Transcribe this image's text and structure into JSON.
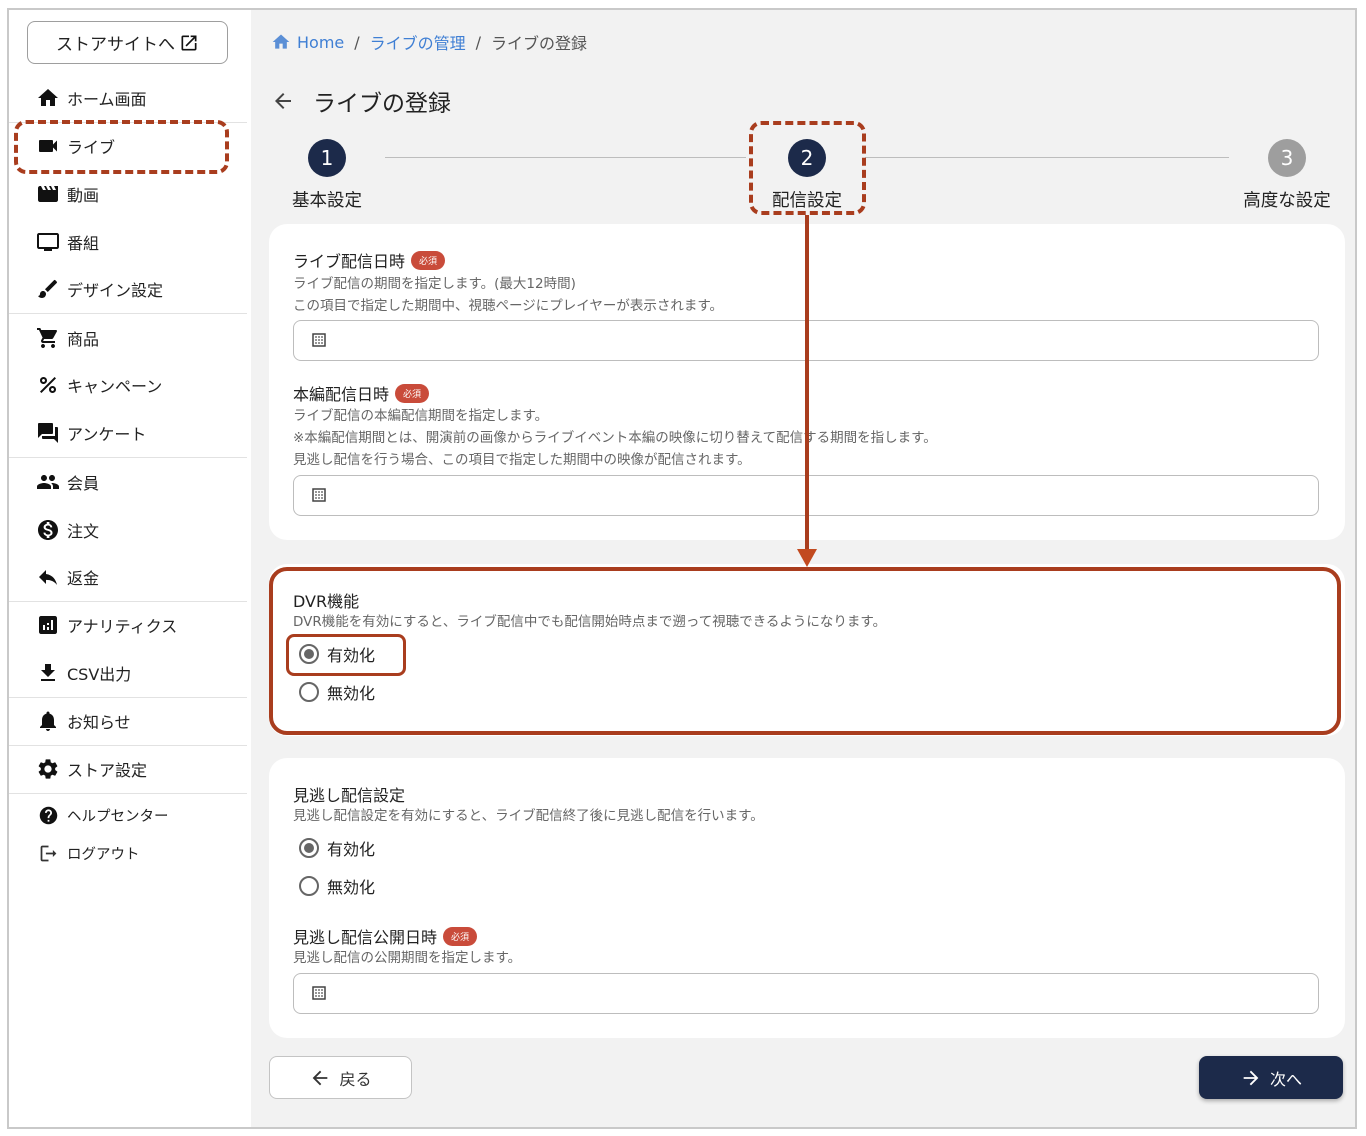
{
  "sidebar": {
    "store_site_label": "ストアサイトへ",
    "items": [
      {
        "label": "ホーム画面",
        "icon": "home-icon"
      },
      {
        "label": "ライブ",
        "icon": "videocam-icon"
      },
      {
        "label": "動画",
        "icon": "movie-icon"
      },
      {
        "label": "番組",
        "icon": "tv-icon"
      },
      {
        "label": "デザイン設定",
        "icon": "brush-icon"
      },
      {
        "label": "商品",
        "icon": "cart-icon"
      },
      {
        "label": "キャンペーン",
        "icon": "percent-icon"
      },
      {
        "label": "アンケート",
        "icon": "forum-icon"
      },
      {
        "label": "会員",
        "icon": "people-icon"
      },
      {
        "label": "注文",
        "icon": "dollar-icon"
      },
      {
        "label": "返金",
        "icon": "reply-icon"
      },
      {
        "label": "アナリティクス",
        "icon": "analytics-icon"
      },
      {
        "label": "CSV出力",
        "icon": "download-icon"
      },
      {
        "label": "お知らせ",
        "icon": "bell-icon"
      },
      {
        "label": "ストア設定",
        "icon": "gear-icon"
      }
    ],
    "help_label": "ヘルプセンター",
    "logout_label": "ログアウト"
  },
  "breadcrumb": {
    "home": "Home",
    "parent": "ライブの管理",
    "current": "ライブの登録",
    "sep": "/"
  },
  "page_title": "ライブの登録",
  "stepper": [
    {
      "num": "1",
      "label": "基本設定",
      "state": "done"
    },
    {
      "num": "2",
      "label": "配信設定",
      "state": "active"
    },
    {
      "num": "3",
      "label": "高度な設定",
      "state": "todo"
    }
  ],
  "card1": {
    "live_datetime": {
      "title": "ライブ配信日時",
      "required": "必須",
      "help1": "ライブ配信の期間を指定します。(最大12時間)",
      "help2": "この項目で指定した期間中、視聴ページにプレイヤーが表示されます。"
    },
    "main_datetime": {
      "title": "本編配信日時",
      "required": "必須",
      "help1": "ライブ配信の本編配信期間を指定します。",
      "help2": "※本編配信期間とは、開演前の画像からライブイベント本編の映像に切り替えて配信する期間を指します。",
      "help3": "見逃し配信を行う場合、この項目で指定した期間中の映像が配信されます。"
    }
  },
  "card2": {
    "title": "DVR機能",
    "help": "DVR機能を有効にすると、ライブ配信中でも配信開始時点まで遡って視聴できるようになります。",
    "enable": "有効化",
    "disable": "無効化",
    "selected": "enable"
  },
  "card3": {
    "title": "見逃し配信設定",
    "help": "見逃し配信設定を有効にすると、ライブ配信終了後に見逃し配信を行います。",
    "enable": "有効化",
    "disable": "無効化",
    "selected": "enable",
    "publish": {
      "title": "見逃し配信公開日時",
      "required": "必須",
      "help": "見逃し配信の公開期間を指定します。"
    }
  },
  "buttons": {
    "back": "戻る",
    "next": "次へ"
  },
  "colors": {
    "accent_navy": "#1c2a4a",
    "required_badge": "#c94b3a",
    "annotation": "#a93d1e",
    "link": "#3f7fd4"
  }
}
